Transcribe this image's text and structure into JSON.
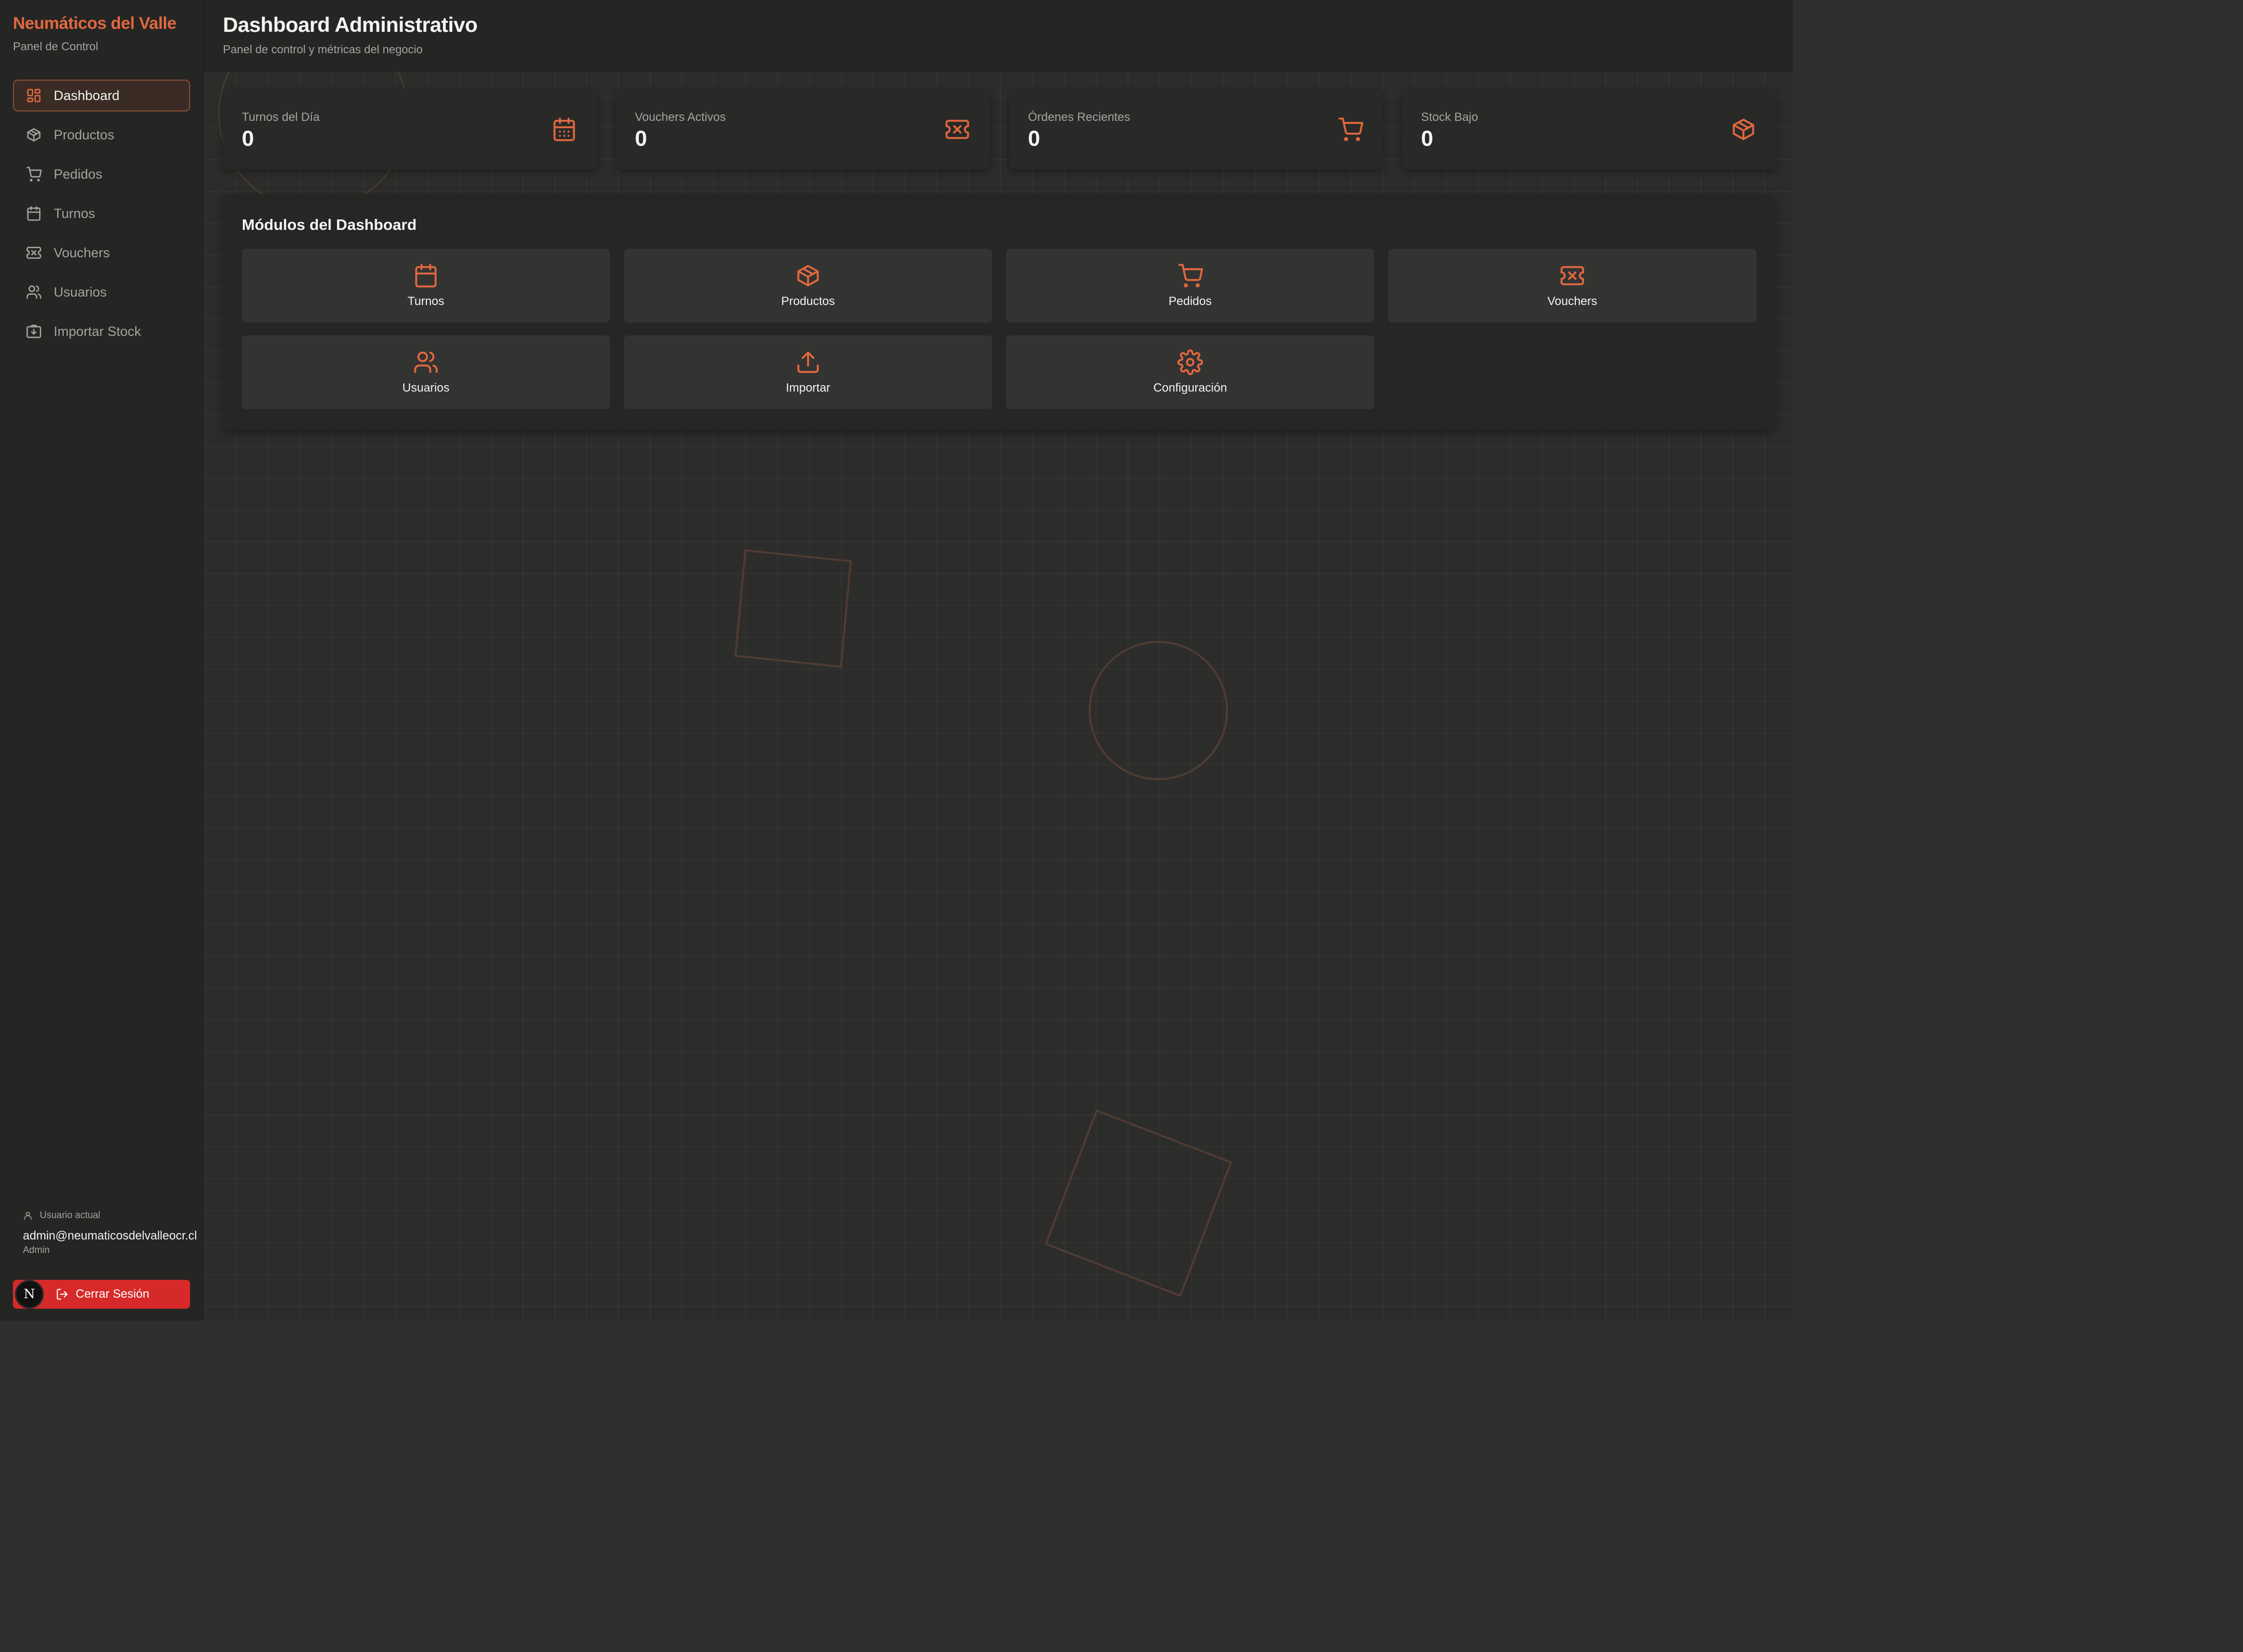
{
  "colors": {
    "accent": "#e0683f",
    "danger": "#d62a2a",
    "sidebar_bg": "#252524",
    "main_bg": "#2c2c2b"
  },
  "sidebar": {
    "brand": "Neumáticos del Valle",
    "subtitle": "Panel de Control",
    "items": [
      {
        "label": "Dashboard",
        "icon": "dashboard-grid-icon",
        "active": true
      },
      {
        "label": "Productos",
        "icon": "box-icon"
      },
      {
        "label": "Pedidos",
        "icon": "cart-icon"
      },
      {
        "label": "Turnos",
        "icon": "calendar-icon"
      },
      {
        "label": "Vouchers",
        "icon": "ticket-icon"
      },
      {
        "label": "Usuarios",
        "icon": "users-icon"
      },
      {
        "label": "Importar Stock",
        "icon": "import-icon"
      }
    ],
    "user": {
      "heading": "Usuario actual",
      "email": "admin@neumaticosdelvalleocr.cl",
      "role": "Admin"
    },
    "logout_label": "Cerrar Sesión",
    "avatar_letter": "N"
  },
  "header": {
    "title": "Dashboard Administrativo",
    "subtitle": "Panel de control y métricas del negocio"
  },
  "stats": [
    {
      "label": "Turnos del Día",
      "value": "0",
      "icon": "calendar-icon"
    },
    {
      "label": "Vouchers Activos",
      "value": "0",
      "icon": "ticket-icon"
    },
    {
      "label": "Órdenes Recientes",
      "value": "0",
      "icon": "cart-icon"
    },
    {
      "label": "Stock Bajo",
      "value": "0",
      "icon": "box-icon"
    }
  ],
  "modules": {
    "title": "Módulos del Dashboard",
    "items": [
      {
        "label": "Turnos",
        "icon": "calendar-icon"
      },
      {
        "label": "Productos",
        "icon": "box-icon"
      },
      {
        "label": "Pedidos",
        "icon": "cart-icon"
      },
      {
        "label": "Vouchers",
        "icon": "ticket-icon"
      },
      {
        "label": "Usuarios",
        "icon": "users-icon"
      },
      {
        "label": "Importar",
        "icon": "upload-icon"
      },
      {
        "label": "Configuración",
        "icon": "gear-icon"
      }
    ]
  }
}
